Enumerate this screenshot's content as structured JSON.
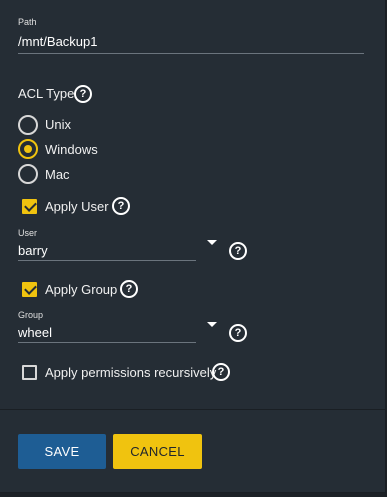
{
  "path": {
    "label": "Path",
    "value": "/mnt/Backup1"
  },
  "acl_type": {
    "label": "ACL Type",
    "options": [
      {
        "label": "Unix",
        "selected": false
      },
      {
        "label": "Windows",
        "selected": true
      },
      {
        "label": "Mac",
        "selected": false
      }
    ]
  },
  "apply_user": {
    "label": "Apply User",
    "checked": true
  },
  "user": {
    "label": "User",
    "value": "barry"
  },
  "apply_group": {
    "label": "Apply Group",
    "checked": true
  },
  "group": {
    "label": "Group",
    "value": "wheel"
  },
  "recursive": {
    "label": "Apply permissions recursively",
    "checked": false
  },
  "help_glyph": "?",
  "buttons": {
    "save": "SAVE",
    "cancel": "CANCEL"
  },
  "colors": {
    "accent": "#f0c30f",
    "primary": "#1e5d94",
    "panel": "#252d35"
  }
}
